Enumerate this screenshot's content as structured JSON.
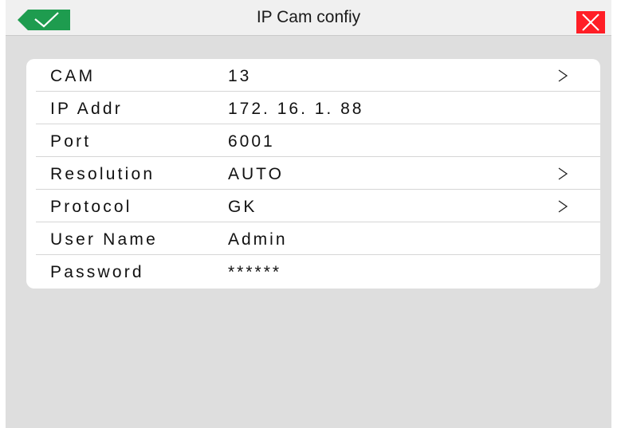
{
  "window": {
    "title": "IP Cam confiy",
    "ok_icon": "check-icon",
    "close_icon": "close-x-icon",
    "accent_ok": "#1e9c4f",
    "accent_close": "#ff1e26"
  },
  "settings": [
    {
      "label": "CAM",
      "value": "13",
      "has_arrow": true
    },
    {
      "label": "IP Addr",
      "value": "172. 16. 1. 88",
      "has_arrow": false
    },
    {
      "label": "Port",
      "value": "6001",
      "has_arrow": false
    },
    {
      "label": "Resolution",
      "value": "AUTO",
      "has_arrow": true
    },
    {
      "label": "Protocol",
      "value": "GK",
      "has_arrow": true
    },
    {
      "label": "User Name",
      "value": "Admin",
      "has_arrow": false
    },
    {
      "label": "Password",
      "value": "******",
      "has_arrow": false
    }
  ]
}
